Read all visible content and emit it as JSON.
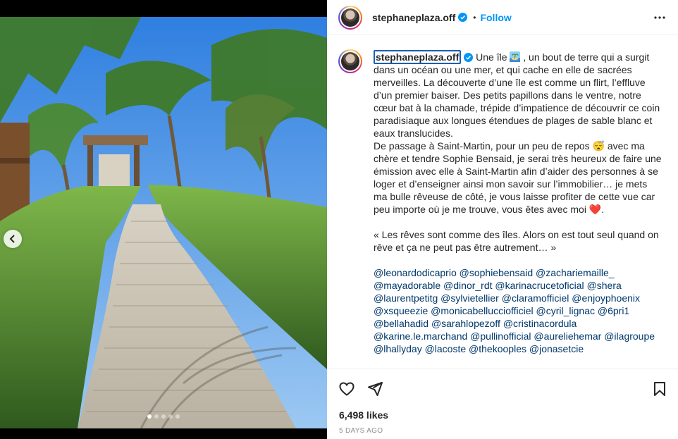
{
  "post": {
    "username": "stephaneplaza.off",
    "separator": "•",
    "follow_label": "Follow",
    "caption": {
      "p1_a": "Une île ",
      "p1_b": " , un bout de terre qui a surgit dans un océan ou une mer, et qui cache en elle de sacrées merveilles. La découverte d’une île est comme un flirt, l’effluve d’un premier baiser. Des petits papillons dans le ventre, notre cœur bat à la chamade, trépide d’impatience de découvrir ce coin paradisiaque aux longues étendues de plages de sable blanc et eaux translucides.",
      "p2_a": "De passage à Saint-Martin, pour un peu de repos ",
      "p2_emoji": "😴",
      "p2_b": " avec ma chère et tendre Sophie Bensaid, je serai très heureux de faire une émission avec elle à Saint-Martin afin d’aider des personnes à se loger et d’enseigner ainsi mon savoir sur l’immobilier… je mets ma bulle rêveuse de côté, je vous laisse profiter de cette vue car peu importe où je me trouve, vous êtes avec moi ",
      "p2_heart": "❤️",
      "p2_end": ".",
      "quote": "« Les rêves sont comme des îles. Alors on est tout seul quand on rêve et ça ne peut pas être autrement… »",
      "mentions": [
        "@leonardodicaprio",
        "@sophiebensaid",
        "@zachariemaille_",
        "@mayadorable",
        "@dinor_rdt",
        "@karinacrucetoficial",
        "@shera",
        "@laurentpetitg",
        "@sylvietellier",
        "@claramofficiel",
        "@enjoyphoenix",
        "@xsqueezie",
        "@monicabelluccіofficiel",
        "@cyril_lignac",
        "@6pri1",
        "@bellahadid",
        "@sarahlopezoff",
        "@cristinacordula",
        "@karine.le.marchand",
        "@pullinofficial",
        "@aureliehemar",
        "@ilagroupe",
        "@lhallyday",
        "@lacoste",
        "@thekooples",
        "@jonasetcie"
      ]
    },
    "likes": "6,498 likes",
    "time_ago": "5 DAYS AGO"
  },
  "icons": {
    "verified": "verified-badge-icon",
    "more": "more-options-icon",
    "like": "heart-icon",
    "share": "paper-plane-icon",
    "save": "bookmark-icon",
    "prev": "chevron-left-icon",
    "island": "island-emoji-icon"
  },
  "colors": {
    "accent": "#0095f6",
    "mention": "#00376b",
    "secondary_text": "#8e8e8e",
    "primary_text": "#262626"
  },
  "carousel": {
    "slide_count": 5,
    "current_slide": 1
  }
}
